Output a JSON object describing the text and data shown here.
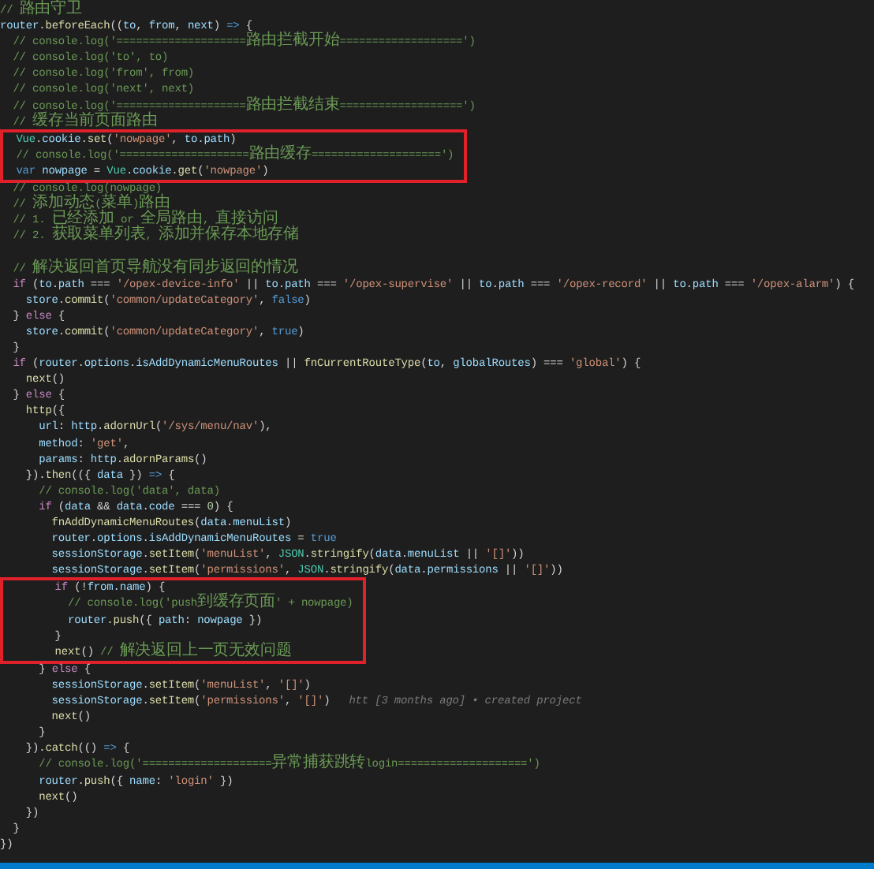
{
  "editor": {
    "blocks": [
      {
        "highlighted": false,
        "lines": [
          {
            "kind": "code",
            "tokens": [
              {
                "kind": "comment",
                "text": "// 路由守卫"
              }
            ]
          },
          {
            "kind": "code",
            "tokens": [
              {
                "kind": "variable",
                "text": "router"
              },
              {
                "kind": "plain",
                "text": "."
              },
              {
                "kind": "function",
                "text": "beforeEach"
              },
              {
                "kind": "plain",
                "text": "(("
              },
              {
                "kind": "variable",
                "text": "to"
              },
              {
                "kind": "plain",
                "text": ", "
              },
              {
                "kind": "variable",
                "text": "from"
              },
              {
                "kind": "plain",
                "text": ", "
              },
              {
                "kind": "variable",
                "text": "next"
              },
              {
                "kind": "plain",
                "text": ") "
              },
              {
                "kind": "storage",
                "text": "=>"
              },
              {
                "kind": "plain",
                "text": " {"
              }
            ]
          },
          {
            "kind": "code",
            "tokens": [
              {
                "kind": "comment",
                "text": "  // console.log('====================路由拦截开始===================')"
              }
            ]
          },
          {
            "kind": "code",
            "tokens": [
              {
                "kind": "comment",
                "text": "  // console.log('to', to)"
              }
            ]
          },
          {
            "kind": "code",
            "tokens": [
              {
                "kind": "comment",
                "text": "  // console.log('from', from)"
              }
            ]
          },
          {
            "kind": "code",
            "tokens": [
              {
                "kind": "comment",
                "text": "  // console.log('next', next)"
              }
            ]
          },
          {
            "kind": "code",
            "tokens": [
              {
                "kind": "comment",
                "text": "  // console.log('====================路由拦截结束===================')"
              }
            ]
          },
          {
            "kind": "code",
            "tokens": [
              {
                "kind": "comment",
                "text": "  // 缓存当前页面路由"
              }
            ]
          }
        ]
      },
      {
        "highlighted": true,
        "lines": [
          {
            "kind": "code",
            "tokens": [
              {
                "kind": "type",
                "text": "  Vue"
              },
              {
                "kind": "plain",
                "text": "."
              },
              {
                "kind": "variable",
                "text": "cookie"
              },
              {
                "kind": "plain",
                "text": "."
              },
              {
                "kind": "function",
                "text": "set"
              },
              {
                "kind": "plain",
                "text": "("
              },
              {
                "kind": "string",
                "text": "'nowpage'"
              },
              {
                "kind": "plain",
                "text": ", "
              },
              {
                "kind": "variable",
                "text": "to"
              },
              {
                "kind": "plain",
                "text": "."
              },
              {
                "kind": "variable",
                "text": "path"
              },
              {
                "kind": "plain",
                "text": ")"
              }
            ]
          },
          {
            "kind": "code",
            "tokens": [
              {
                "kind": "comment",
                "text": "  // console.log('====================路由缓存====================')"
              }
            ]
          },
          {
            "kind": "code",
            "tokens": [
              {
                "kind": "storage",
                "text": "  var"
              },
              {
                "kind": "variable",
                "text": " nowpage"
              },
              {
                "kind": "plain",
                "text": " = "
              },
              {
                "kind": "type",
                "text": "Vue"
              },
              {
                "kind": "plain",
                "text": "."
              },
              {
                "kind": "variable",
                "text": "cookie"
              },
              {
                "kind": "plain",
                "text": "."
              },
              {
                "kind": "function",
                "text": "get"
              },
              {
                "kind": "plain",
                "text": "("
              },
              {
                "kind": "string",
                "text": "'nowpage'"
              },
              {
                "kind": "plain",
                "text": ")"
              }
            ]
          }
        ]
      },
      {
        "highlighted": false,
        "lines": [
          {
            "kind": "code",
            "tokens": [
              {
                "kind": "comment",
                "text": "  // console.log(nowpage)"
              }
            ]
          },
          {
            "kind": "code",
            "tokens": [
              {
                "kind": "comment",
                "text": "  // 添加动态(菜单)路由"
              }
            ]
          },
          {
            "kind": "code",
            "tokens": [
              {
                "kind": "comment",
                "text": "  // 1. 已经添加 or 全局路由, 直接访问"
              }
            ]
          },
          {
            "kind": "code",
            "tokens": [
              {
                "kind": "comment",
                "text": "  // 2. 获取菜单列表, 添加并保存本地存储"
              }
            ]
          },
          {
            "kind": "blank"
          },
          {
            "kind": "code",
            "tokens": [
              {
                "kind": "comment",
                "text": "  // 解决返回首页导航没有同步返回的情况"
              }
            ]
          },
          {
            "kind": "code",
            "tokens": [
              {
                "kind": "keyword",
                "text": "  if"
              },
              {
                "kind": "plain",
                "text": " ("
              },
              {
                "kind": "variable",
                "text": "to"
              },
              {
                "kind": "plain",
                "text": "."
              },
              {
                "kind": "variable",
                "text": "path"
              },
              {
                "kind": "plain",
                "text": " === "
              },
              {
                "kind": "string",
                "text": "'/opex-device-info'"
              },
              {
                "kind": "plain",
                "text": " || "
              },
              {
                "kind": "variable",
                "text": "to"
              },
              {
                "kind": "plain",
                "text": "."
              },
              {
                "kind": "variable",
                "text": "path"
              },
              {
                "kind": "plain",
                "text": " === "
              },
              {
                "kind": "string",
                "text": "'/opex-supervise'"
              },
              {
                "kind": "plain",
                "text": " || "
              },
              {
                "kind": "variable",
                "text": "to"
              },
              {
                "kind": "plain",
                "text": "."
              },
              {
                "kind": "variable",
                "text": "path"
              },
              {
                "kind": "plain",
                "text": " === "
              },
              {
                "kind": "string",
                "text": "'/opex-record'"
              },
              {
                "kind": "plain",
                "text": " || "
              },
              {
                "kind": "variable",
                "text": "to"
              },
              {
                "kind": "plain",
                "text": "."
              },
              {
                "kind": "variable",
                "text": "path"
              },
              {
                "kind": "plain",
                "text": " === "
              },
              {
                "kind": "string",
                "text": "'/opex-alarm'"
              },
              {
                "kind": "plain",
                "text": ") {"
              }
            ]
          },
          {
            "kind": "code",
            "tokens": [
              {
                "kind": "variable",
                "text": "    store"
              },
              {
                "kind": "plain",
                "text": "."
              },
              {
                "kind": "function",
                "text": "commit"
              },
              {
                "kind": "plain",
                "text": "("
              },
              {
                "kind": "string",
                "text": "'common/updateCategory'"
              },
              {
                "kind": "plain",
                "text": ", "
              },
              {
                "kind": "storage",
                "text": "false"
              },
              {
                "kind": "plain",
                "text": ")"
              }
            ]
          },
          {
            "kind": "code",
            "tokens": [
              {
                "kind": "plain",
                "text": "  } "
              },
              {
                "kind": "keyword",
                "text": "else"
              },
              {
                "kind": "plain",
                "text": " {"
              }
            ]
          },
          {
            "kind": "code",
            "tokens": [
              {
                "kind": "variable",
                "text": "    store"
              },
              {
                "kind": "plain",
                "text": "."
              },
              {
                "kind": "function",
                "text": "commit"
              },
              {
                "kind": "plain",
                "text": "("
              },
              {
                "kind": "string",
                "text": "'common/updateCategory'"
              },
              {
                "kind": "plain",
                "text": ", "
              },
              {
                "kind": "storage",
                "text": "true"
              },
              {
                "kind": "plain",
                "text": ")"
              }
            ]
          },
          {
            "kind": "code",
            "tokens": [
              {
                "kind": "plain",
                "text": "  }"
              }
            ]
          },
          {
            "kind": "code",
            "tokens": [
              {
                "kind": "keyword",
                "text": "  if"
              },
              {
                "kind": "plain",
                "text": " ("
              },
              {
                "kind": "variable",
                "text": "router"
              },
              {
                "kind": "plain",
                "text": "."
              },
              {
                "kind": "variable",
                "text": "options"
              },
              {
                "kind": "plain",
                "text": "."
              },
              {
                "kind": "variable",
                "text": "isAddDynamicMenuRoutes"
              },
              {
                "kind": "plain",
                "text": " || "
              },
              {
                "kind": "function",
                "text": "fnCurrentRouteType"
              },
              {
                "kind": "plain",
                "text": "("
              },
              {
                "kind": "variable",
                "text": "to"
              },
              {
                "kind": "plain",
                "text": ", "
              },
              {
                "kind": "variable",
                "text": "globalRoutes"
              },
              {
                "kind": "plain",
                "text": ") === "
              },
              {
                "kind": "string",
                "text": "'global'"
              },
              {
                "kind": "plain",
                "text": ") {"
              }
            ]
          },
          {
            "kind": "code",
            "tokens": [
              {
                "kind": "function",
                "text": "    next"
              },
              {
                "kind": "plain",
                "text": "()"
              }
            ]
          },
          {
            "kind": "code",
            "tokens": [
              {
                "kind": "plain",
                "text": "  } "
              },
              {
                "kind": "keyword",
                "text": "else"
              },
              {
                "kind": "plain",
                "text": " {"
              }
            ]
          },
          {
            "kind": "code",
            "tokens": [
              {
                "kind": "function",
                "text": "    http"
              },
              {
                "kind": "plain",
                "text": "({"
              }
            ]
          },
          {
            "kind": "code",
            "tokens": [
              {
                "kind": "variable",
                "text": "      url"
              },
              {
                "kind": "plain",
                "text": ": "
              },
              {
                "kind": "variable",
                "text": "http"
              },
              {
                "kind": "plain",
                "text": "."
              },
              {
                "kind": "function",
                "text": "adornUrl"
              },
              {
                "kind": "plain",
                "text": "("
              },
              {
                "kind": "string",
                "text": "'/sys/menu/nav'"
              },
              {
                "kind": "plain",
                "text": "),"
              }
            ]
          },
          {
            "kind": "code",
            "tokens": [
              {
                "kind": "variable",
                "text": "      method"
              },
              {
                "kind": "plain",
                "text": ": "
              },
              {
                "kind": "string",
                "text": "'get'"
              },
              {
                "kind": "plain",
                "text": ","
              }
            ]
          },
          {
            "kind": "code",
            "tokens": [
              {
                "kind": "variable",
                "text": "      params"
              },
              {
                "kind": "plain",
                "text": ": "
              },
              {
                "kind": "variable",
                "text": "http"
              },
              {
                "kind": "plain",
                "text": "."
              },
              {
                "kind": "function",
                "text": "adornParams"
              },
              {
                "kind": "plain",
                "text": "()"
              }
            ]
          },
          {
            "kind": "code",
            "tokens": [
              {
                "kind": "plain",
                "text": "    })."
              },
              {
                "kind": "function",
                "text": "then"
              },
              {
                "kind": "plain",
                "text": "(({ "
              },
              {
                "kind": "variable",
                "text": "data"
              },
              {
                "kind": "plain",
                "text": " }) "
              },
              {
                "kind": "storage",
                "text": "=>"
              },
              {
                "kind": "plain",
                "text": " {"
              }
            ]
          },
          {
            "kind": "code",
            "tokens": [
              {
                "kind": "comment",
                "text": "      // console.log('data', data)"
              }
            ]
          },
          {
            "kind": "code",
            "tokens": [
              {
                "kind": "keyword",
                "text": "      if"
              },
              {
                "kind": "plain",
                "text": " ("
              },
              {
                "kind": "variable",
                "text": "data"
              },
              {
                "kind": "plain",
                "text": " && "
              },
              {
                "kind": "variable",
                "text": "data"
              },
              {
                "kind": "plain",
                "text": "."
              },
              {
                "kind": "variable",
                "text": "code"
              },
              {
                "kind": "plain",
                "text": " === "
              },
              {
                "kind": "number",
                "text": "0"
              },
              {
                "kind": "plain",
                "text": ") {"
              }
            ]
          },
          {
            "kind": "code",
            "tokens": [
              {
                "kind": "function",
                "text": "        fnAddDynamicMenuRoutes"
              },
              {
                "kind": "plain",
                "text": "("
              },
              {
                "kind": "variable",
                "text": "data"
              },
              {
                "kind": "plain",
                "text": "."
              },
              {
                "kind": "variable",
                "text": "menuList"
              },
              {
                "kind": "plain",
                "text": ")"
              }
            ]
          },
          {
            "kind": "code",
            "tokens": [
              {
                "kind": "variable",
                "text": "        router"
              },
              {
                "kind": "plain",
                "text": "."
              },
              {
                "kind": "variable",
                "text": "options"
              },
              {
                "kind": "plain",
                "text": "."
              },
              {
                "kind": "variable",
                "text": "isAddDynamicMenuRoutes"
              },
              {
                "kind": "plain",
                "text": " = "
              },
              {
                "kind": "storage",
                "text": "true"
              }
            ]
          },
          {
            "kind": "code",
            "tokens": [
              {
                "kind": "variable",
                "text": "        sessionStorage"
              },
              {
                "kind": "plain",
                "text": "."
              },
              {
                "kind": "function",
                "text": "setItem"
              },
              {
                "kind": "plain",
                "text": "("
              },
              {
                "kind": "string",
                "text": "'menuList'"
              },
              {
                "kind": "plain",
                "text": ", "
              },
              {
                "kind": "type",
                "text": "JSON"
              },
              {
                "kind": "plain",
                "text": "."
              },
              {
                "kind": "function",
                "text": "stringify"
              },
              {
                "kind": "plain",
                "text": "("
              },
              {
                "kind": "variable",
                "text": "data"
              },
              {
                "kind": "plain",
                "text": "."
              },
              {
                "kind": "variable",
                "text": "menuList"
              },
              {
                "kind": "plain",
                "text": " || "
              },
              {
                "kind": "string",
                "text": "'[]'"
              },
              {
                "kind": "plain",
                "text": "))"
              }
            ]
          },
          {
            "kind": "code",
            "tokens": [
              {
                "kind": "variable",
                "text": "        sessionStorage"
              },
              {
                "kind": "plain",
                "text": "."
              },
              {
                "kind": "function",
                "text": "setItem"
              },
              {
                "kind": "plain",
                "text": "("
              },
              {
                "kind": "string",
                "text": "'permissions'"
              },
              {
                "kind": "plain",
                "text": ", "
              },
              {
                "kind": "type",
                "text": "JSON"
              },
              {
                "kind": "plain",
                "text": "."
              },
              {
                "kind": "function",
                "text": "stringify"
              },
              {
                "kind": "plain",
                "text": "("
              },
              {
                "kind": "variable",
                "text": "data"
              },
              {
                "kind": "plain",
                "text": "."
              },
              {
                "kind": "variable",
                "text": "permissions"
              },
              {
                "kind": "plain",
                "text": " || "
              },
              {
                "kind": "string",
                "text": "'[]'"
              },
              {
                "kind": "plain",
                "text": "))"
              }
            ]
          }
        ]
      },
      {
        "highlighted": true,
        "lines": [
          {
            "kind": "code",
            "tokens": [
              {
                "kind": "keyword",
                "text": "        if"
              },
              {
                "kind": "plain",
                "text": " (!"
              },
              {
                "kind": "variable",
                "text": "from"
              },
              {
                "kind": "plain",
                "text": "."
              },
              {
                "kind": "variable",
                "text": "name"
              },
              {
                "kind": "plain",
                "text": ") {"
              }
            ]
          },
          {
            "kind": "code",
            "tokens": [
              {
                "kind": "comment",
                "text": "          // console.log('push到缓存页面' + nowpage)"
              }
            ]
          },
          {
            "kind": "code",
            "tokens": [
              {
                "kind": "variable",
                "text": "          router"
              },
              {
                "kind": "plain",
                "text": "."
              },
              {
                "kind": "function",
                "text": "push"
              },
              {
                "kind": "plain",
                "text": "({ "
              },
              {
                "kind": "variable",
                "text": "path"
              },
              {
                "kind": "plain",
                "text": ": "
              },
              {
                "kind": "variable",
                "text": "nowpage"
              },
              {
                "kind": "plain",
                "text": " })"
              }
            ]
          },
          {
            "kind": "code",
            "tokens": [
              {
                "kind": "plain",
                "text": "        }"
              }
            ]
          },
          {
            "kind": "code",
            "tokens": [
              {
                "kind": "function",
                "text": "        next"
              },
              {
                "kind": "plain",
                "text": "() "
              },
              {
                "kind": "comment",
                "text": "// 解决返回上一页无效问题"
              }
            ]
          }
        ]
      },
      {
        "highlighted": false,
        "lines": [
          {
            "kind": "code",
            "tokens": [
              {
                "kind": "plain",
                "text": "      } "
              },
              {
                "kind": "keyword",
                "text": "else"
              },
              {
                "kind": "plain",
                "text": " {"
              }
            ]
          },
          {
            "kind": "code",
            "tokens": [
              {
                "kind": "variable",
                "text": "        sessionStorage"
              },
              {
                "kind": "plain",
                "text": "."
              },
              {
                "kind": "function",
                "text": "setItem"
              },
              {
                "kind": "plain",
                "text": "("
              },
              {
                "kind": "string",
                "text": "'menuList'"
              },
              {
                "kind": "plain",
                "text": ", "
              },
              {
                "kind": "string",
                "text": "'[]'"
              },
              {
                "kind": "plain",
                "text": ")"
              }
            ]
          },
          {
            "kind": "code",
            "blame": "htt [3 months ago] • created project",
            "tokens": [
              {
                "kind": "variable",
                "text": "        sessionStorage"
              },
              {
                "kind": "plain",
                "text": "."
              },
              {
                "kind": "function",
                "text": "setItem"
              },
              {
                "kind": "plain",
                "text": "("
              },
              {
                "kind": "string",
                "text": "'permissions'"
              },
              {
                "kind": "plain",
                "text": ", "
              },
              {
                "kind": "string",
                "text": "'[]'"
              },
              {
                "kind": "plain",
                "text": ")"
              }
            ]
          },
          {
            "kind": "code",
            "tokens": [
              {
                "kind": "function",
                "text": "        next"
              },
              {
                "kind": "plain",
                "text": "()"
              }
            ]
          },
          {
            "kind": "code",
            "tokens": [
              {
                "kind": "plain",
                "text": "      }"
              }
            ]
          },
          {
            "kind": "code",
            "tokens": [
              {
                "kind": "plain",
                "text": "    })."
              },
              {
                "kind": "function",
                "text": "catch"
              },
              {
                "kind": "plain",
                "text": "(() "
              },
              {
                "kind": "storage",
                "text": "=>"
              },
              {
                "kind": "plain",
                "text": " {"
              }
            ]
          },
          {
            "kind": "code",
            "tokens": [
              {
                "kind": "comment",
                "text": "      // console.log('====================异常捕获跳转login====================')"
              }
            ]
          },
          {
            "kind": "code",
            "tokens": [
              {
                "kind": "variable",
                "text": "      router"
              },
              {
                "kind": "plain",
                "text": "."
              },
              {
                "kind": "function",
                "text": "push"
              },
              {
                "kind": "plain",
                "text": "({ "
              },
              {
                "kind": "variable",
                "text": "name"
              },
              {
                "kind": "plain",
                "text": ": "
              },
              {
                "kind": "string",
                "text": "'login'"
              },
              {
                "kind": "plain",
                "text": " })"
              }
            ]
          },
          {
            "kind": "code",
            "tokens": [
              {
                "kind": "function",
                "text": "      next"
              },
              {
                "kind": "plain",
                "text": "()"
              }
            ]
          },
          {
            "kind": "code",
            "tokens": [
              {
                "kind": "plain",
                "text": "    })"
              }
            ]
          },
          {
            "kind": "code",
            "tokens": [
              {
                "kind": "plain",
                "text": "  }"
              }
            ]
          },
          {
            "kind": "code",
            "tokens": [
              {
                "kind": "plain",
                "text": "})"
              }
            ]
          }
        ]
      }
    ]
  }
}
